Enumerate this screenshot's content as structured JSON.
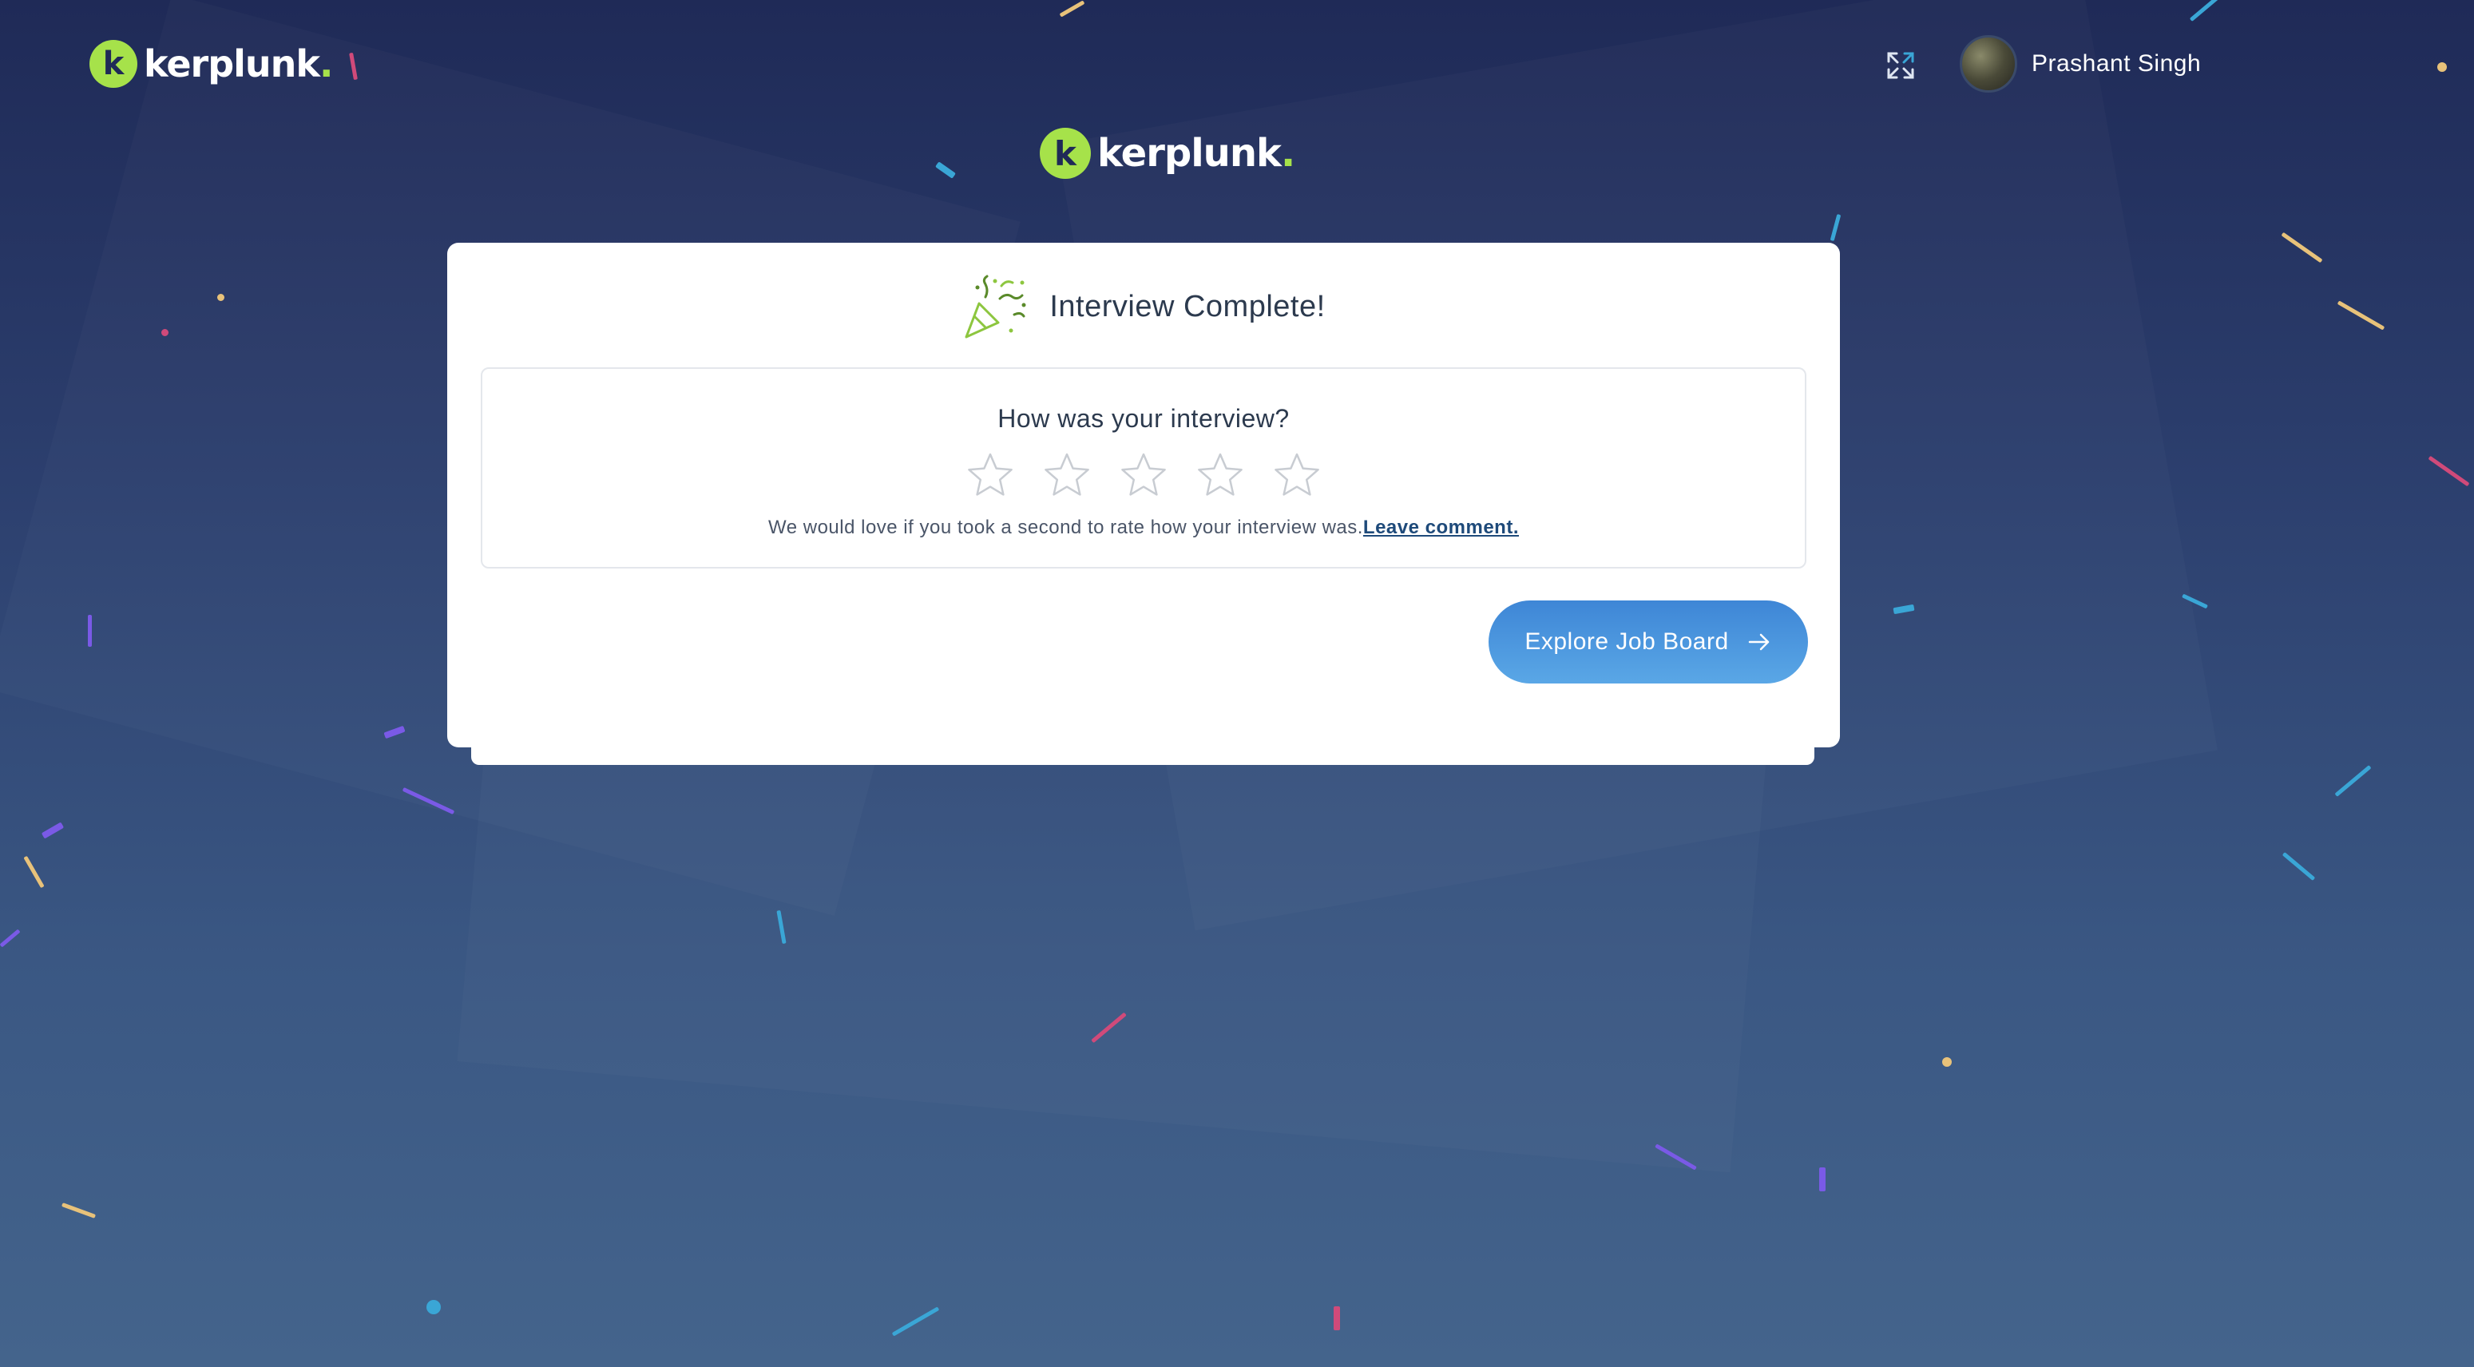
{
  "header": {
    "logo_letter": "k",
    "logo_text": "kerplunk",
    "logo_dot": ".",
    "fullscreen_icon": "expand-icon",
    "user_name": "Prashant Singh"
  },
  "center_logo": {
    "logo_letter": "k",
    "logo_text": "kerplunk",
    "logo_dot": "."
  },
  "card": {
    "icon": "party-popper-icon",
    "title": "Interview Complete!",
    "rating": {
      "question": "How was your interview?",
      "stars_total": 5,
      "stars_selected": 0,
      "note": "We would love if you took a second to rate how your interview was.",
      "comment_link": "Leave comment."
    },
    "explore_button": "Explore Job Board"
  },
  "colors": {
    "brand_green": "#a6e24a",
    "button_blue": "#4a96de",
    "background_top": "#1f2a57",
    "background_bottom": "#44648c"
  }
}
